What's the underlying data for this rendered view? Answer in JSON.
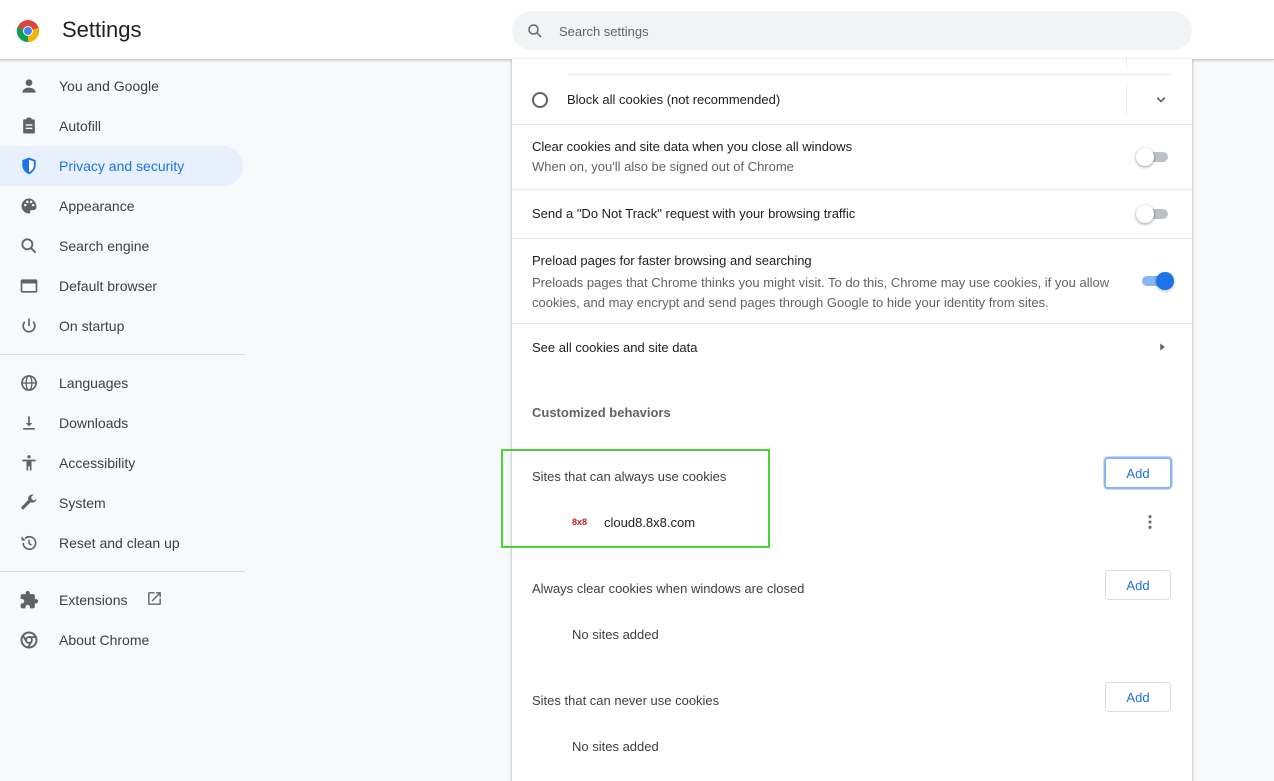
{
  "header": {
    "title": "Settings",
    "search_placeholder": "Search settings"
  },
  "sidebar": {
    "items": [
      {
        "label": "You and Google",
        "icon": "person-icon"
      },
      {
        "label": "Autofill",
        "icon": "clipboard-icon"
      },
      {
        "label": "Privacy and security",
        "icon": "shield-icon",
        "active": true
      },
      {
        "label": "Appearance",
        "icon": "palette-icon"
      },
      {
        "label": "Search engine",
        "icon": "search-icon"
      },
      {
        "label": "Default browser",
        "icon": "browser-window-icon"
      },
      {
        "label": "On startup",
        "icon": "power-icon"
      }
    ],
    "advanced": [
      {
        "label": "Languages",
        "icon": "globe-icon"
      },
      {
        "label": "Downloads",
        "icon": "download-icon"
      },
      {
        "label": "Accessibility",
        "icon": "accessibility-icon"
      },
      {
        "label": "System",
        "icon": "wrench-icon"
      },
      {
        "label": "Reset and clean up",
        "icon": "history-icon"
      }
    ],
    "footer": [
      {
        "label": "Extensions",
        "icon": "puzzle-icon",
        "external_icon": "open-in-new-icon"
      },
      {
        "label": "About Chrome",
        "icon": "chrome-icon"
      }
    ]
  },
  "cookies": {
    "block_all_label": "Block all cookies (not recommended)",
    "clear_on_exit": {
      "title": "Clear cookies and site data when you close all windows",
      "subtitle": "When on, you'll also be signed out of Chrome",
      "enabled": false
    },
    "do_not_track": {
      "title": "Send a \"Do Not Track\" request with your browsing traffic",
      "enabled": false
    },
    "preload": {
      "title": "Preload pages for faster browsing and searching",
      "subtitle": "Preloads pages that Chrome thinks you might visit. To do this, Chrome may use cookies, if you allow cookies, and may encrypt and send pages through Google to hide your identity from sites.",
      "enabled": true
    },
    "see_all_label": "See all cookies and site data"
  },
  "customized": {
    "heading": "Customized behaviors",
    "add_label": "Add",
    "always_allow": {
      "title": "Sites that can always use cookies",
      "sites": [
        {
          "favicon_text": "8x8",
          "domain": "cloud8.8x8.com"
        }
      ]
    },
    "clear_on_close": {
      "title": "Always clear cookies when windows are closed",
      "empty_text": "No sites added"
    },
    "never_allow": {
      "title": "Sites that can never use cookies",
      "empty_text": "No sites added"
    }
  },
  "colors": {
    "accent": "#1a73e8",
    "active_nav_bg": "#e8f0fe",
    "highlight_box": "#4cd137"
  }
}
